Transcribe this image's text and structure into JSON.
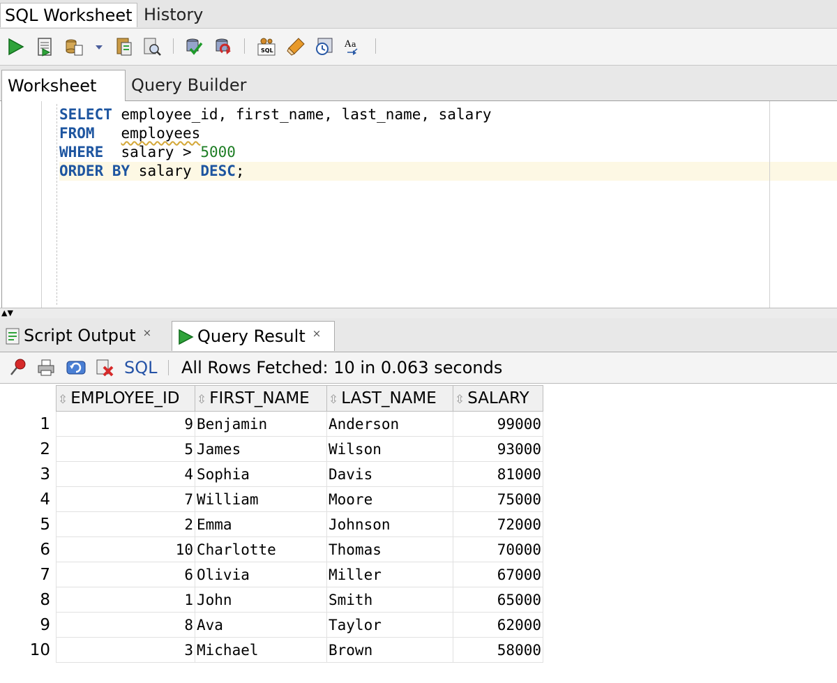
{
  "top_tabs": {
    "sql_worksheet": "SQL Worksheet",
    "history": "History"
  },
  "worksheet_tabs": {
    "worksheet": "Worksheet",
    "query_builder": "Query Builder"
  },
  "editor": {
    "lines": [
      {
        "kw": "SELECT",
        "rest": " employee_id, first_name, last_name, salary"
      },
      {
        "kw": "FROM",
        "pad": "   ",
        "rest": "employees"
      },
      {
        "kw": "WHERE",
        "pad": "  ",
        "rest": "salary > ",
        "num": "5000"
      },
      {
        "kw": "ORDER BY",
        "rest": " salary ",
        "kw2": "DESC",
        "end": ";"
      }
    ]
  },
  "result_tabs": {
    "script_output": "Script Output",
    "query_result": "Query Result",
    "close": "×"
  },
  "result_toolbar": {
    "sql_label": "SQL",
    "status": "All Rows Fetched: 10 in 0.063 seconds"
  },
  "grid": {
    "columns": [
      "EMPLOYEE_ID",
      "FIRST_NAME",
      "LAST_NAME",
      "SALARY"
    ],
    "rows": [
      [
        "1",
        "9",
        "Benjamin",
        "Anderson",
        "99000"
      ],
      [
        "2",
        "5",
        "James",
        "Wilson",
        "93000"
      ],
      [
        "3",
        "4",
        "Sophia",
        "Davis",
        "81000"
      ],
      [
        "4",
        "7",
        "William",
        "Moore",
        "75000"
      ],
      [
        "5",
        "2",
        "Emma",
        "Johnson",
        "72000"
      ],
      [
        "6",
        "10",
        "Charlotte",
        "Thomas",
        "70000"
      ],
      [
        "7",
        "6",
        "Olivia",
        "Miller",
        "67000"
      ],
      [
        "8",
        "1",
        "John",
        "Smith",
        "65000"
      ],
      [
        "9",
        "8",
        "Ava",
        "Taylor",
        "62000"
      ],
      [
        "10",
        "3",
        "Michael",
        "Brown",
        "58000"
      ]
    ]
  },
  "colors": {
    "keyword": "#1d55a0",
    "number": "#1d7d24",
    "run_green": "#2fa33a",
    "current_line": "#fdf8e4"
  },
  "icons": [
    "run-statement-icon",
    "run-script-icon",
    "autotrace-icon",
    "dropdown-arrow-icon",
    "explain-plan-icon",
    "sql-tuning-icon",
    "commit-icon",
    "rollback-icon",
    "unshared-sql-icon",
    "clear-icon",
    "history-icon",
    "format-text-icon",
    "pin-icon",
    "print-icon",
    "refresh-icon",
    "delete-icon"
  ]
}
